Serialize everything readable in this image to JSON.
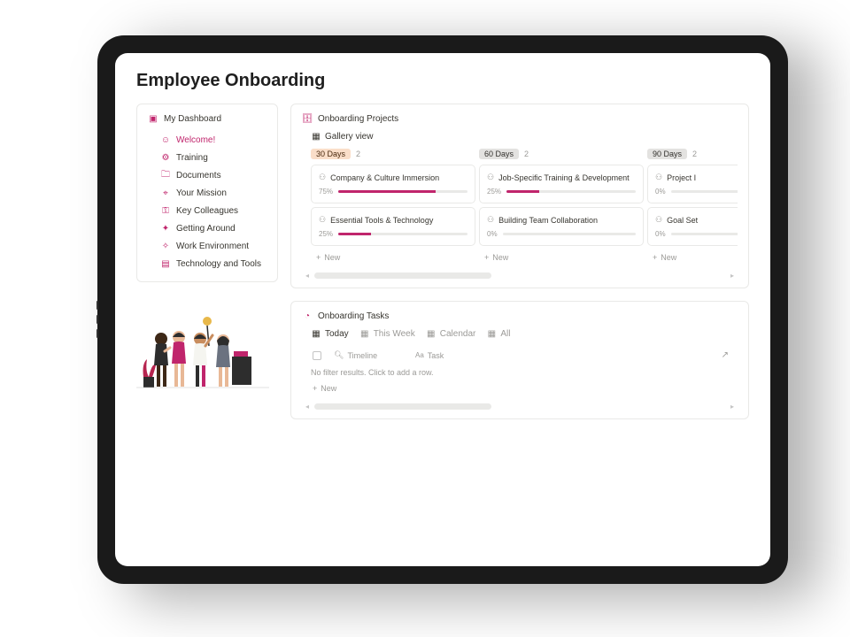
{
  "page": {
    "title": "Employee Onboarding"
  },
  "sidebar": {
    "title": "My Dashboard",
    "items": [
      {
        "label": "Welcome!",
        "icon": "☺",
        "pink": true
      },
      {
        "label": "Training",
        "icon": "⚙"
      },
      {
        "label": "Documents",
        "icon": "🗀"
      },
      {
        "label": "Your Mission",
        "icon": "⌖"
      },
      {
        "label": "Key Colleagues",
        "icon": "⚿"
      },
      {
        "label": "Getting Around",
        "icon": "✦"
      },
      {
        "label": "Work Environment",
        "icon": "✧"
      },
      {
        "label": "Technology and Tools",
        "icon": "▤"
      }
    ]
  },
  "projects": {
    "title": "Onboarding Projects",
    "view_label": "Gallery view",
    "columns": [
      {
        "tag": "30 Days",
        "tag_class": "tag-orange",
        "count": "2",
        "cards": [
          {
            "title": "Company & Culture Immersion",
            "percent": "75%",
            "fill": 75
          },
          {
            "title": "Essential Tools & Technology",
            "percent": "25%",
            "fill": 25
          }
        ]
      },
      {
        "tag": "60 Days",
        "tag_class": "tag-grey",
        "count": "2",
        "cards": [
          {
            "title": "Job-Specific Training & Development",
            "percent": "25%",
            "fill": 25
          },
          {
            "title": "Building Team Collaboration",
            "percent": "0%",
            "fill": 0
          }
        ]
      },
      {
        "tag": "90 Days",
        "tag_class": "tag-grey",
        "count": "2",
        "cards": [
          {
            "title": "Project I",
            "percent": "0%",
            "fill": 0
          },
          {
            "title": "Goal Set",
            "percent": "0%",
            "fill": 0
          }
        ]
      }
    ],
    "new_label": "New"
  },
  "tasks": {
    "title": "Onboarding Tasks",
    "tabs": [
      {
        "label": "Today",
        "active": true
      },
      {
        "label": "This Week",
        "active": false
      },
      {
        "label": "Calendar",
        "active": false
      },
      {
        "label": "All",
        "active": false
      }
    ],
    "columns": {
      "timeline": "Timeline",
      "task": "Task"
    },
    "empty": "No filter results. Click to add a row.",
    "new_label": "New"
  }
}
